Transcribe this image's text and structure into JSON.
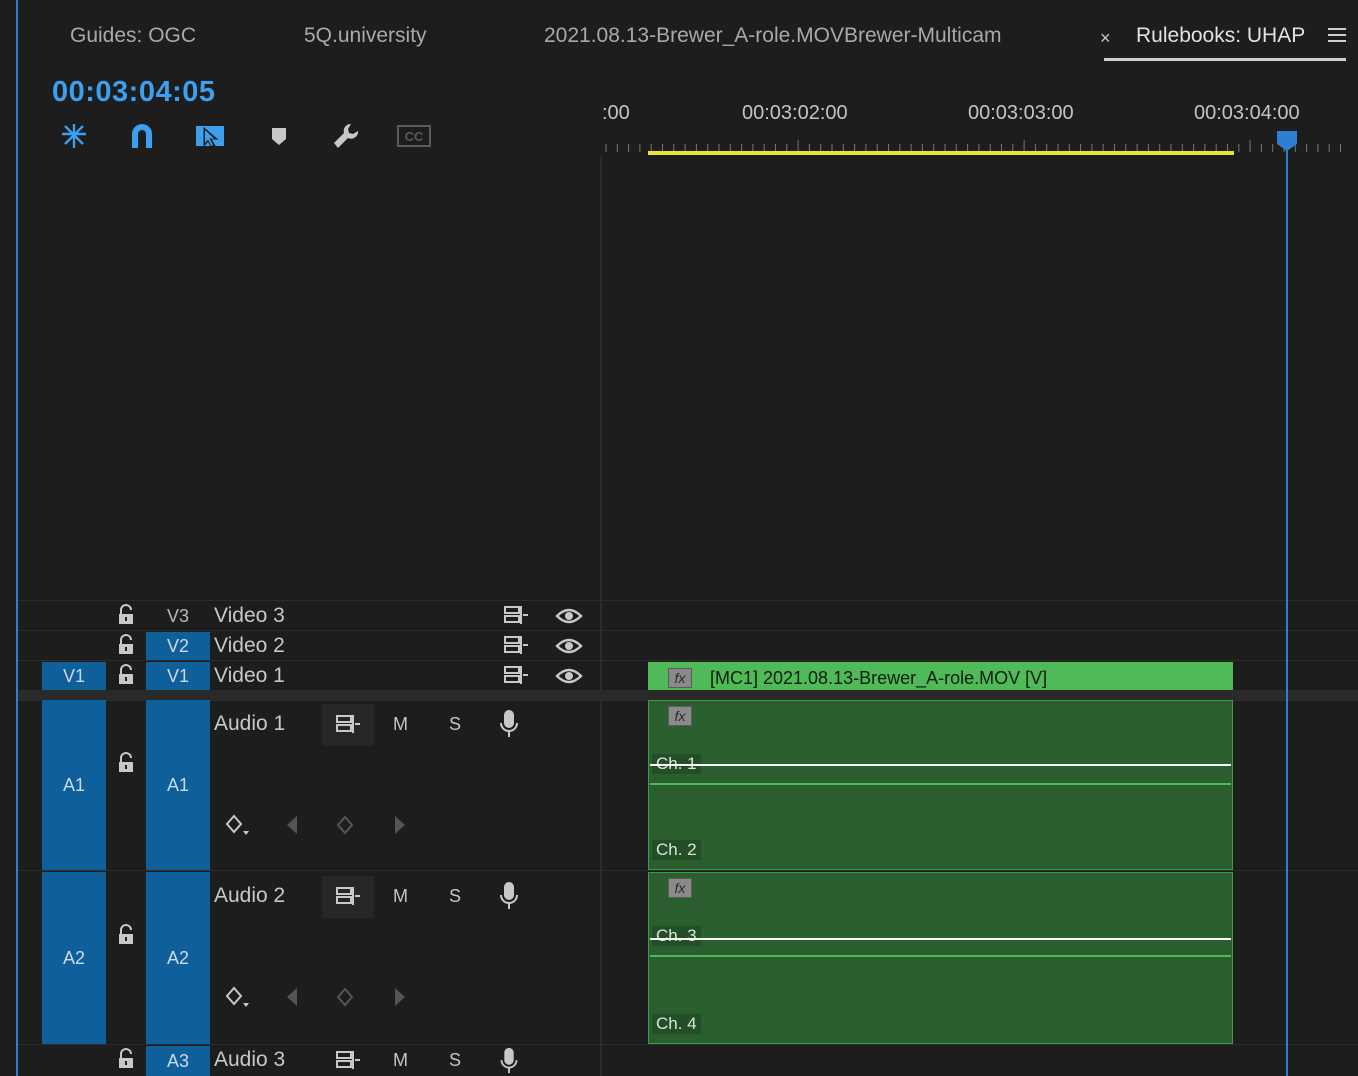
{
  "tabs": [
    {
      "label": "Guides: OGC"
    },
    {
      "label": "5Q.university"
    },
    {
      "label": "2021.08.13-Brewer_A-role.MOVBrewer-Multicam"
    },
    {
      "label": "Rulebooks: UHAP",
      "active": true
    }
  ],
  "tab_close_glyph": "×",
  "timecode": "00:03:04:05",
  "toolbar": {
    "icons": [
      "nest-sequence-icon",
      "snap-magnet-icon",
      "linked-selection-icon",
      "add-marker-icon",
      "wrench-settings-icon",
      "captions-icon"
    ],
    "captions_label": "CC"
  },
  "ruler": {
    "labels": [
      ":00",
      "00:03:02:00",
      "00:03:03:00",
      "00:03:04:00"
    ]
  },
  "tracks": {
    "video": [
      {
        "source": "",
        "target": "V3",
        "name": "Video 3"
      },
      {
        "source": "",
        "target": "V2",
        "name": "Video 2"
      },
      {
        "source": "V1",
        "target": "V1",
        "name": "Video 1"
      }
    ],
    "audio": [
      {
        "source": "A1",
        "target": "A1",
        "name": "Audio 1",
        "mute": "M",
        "solo": "S"
      },
      {
        "source": "A2",
        "target": "A2",
        "name": "Audio 2",
        "mute": "M",
        "solo": "S"
      },
      {
        "source": "",
        "target": "A3",
        "name": "Audio 3",
        "mute": "M",
        "solo": "S"
      }
    ]
  },
  "clips": {
    "video_label": "[MC1] 2021.08.13-Brewer_A-role.MOV [V]",
    "fx_label": "fx",
    "channels": [
      "Ch. 1",
      "Ch. 2",
      "Ch. 3",
      "Ch. 4"
    ]
  },
  "colors": {
    "accent": "#2f7fd0",
    "timecode": "#3d9fef",
    "patch": "#0f5f9a",
    "video_clip": "#4fba57",
    "audio_clip": "#2a5e2e",
    "work_area": "#e8e630"
  }
}
